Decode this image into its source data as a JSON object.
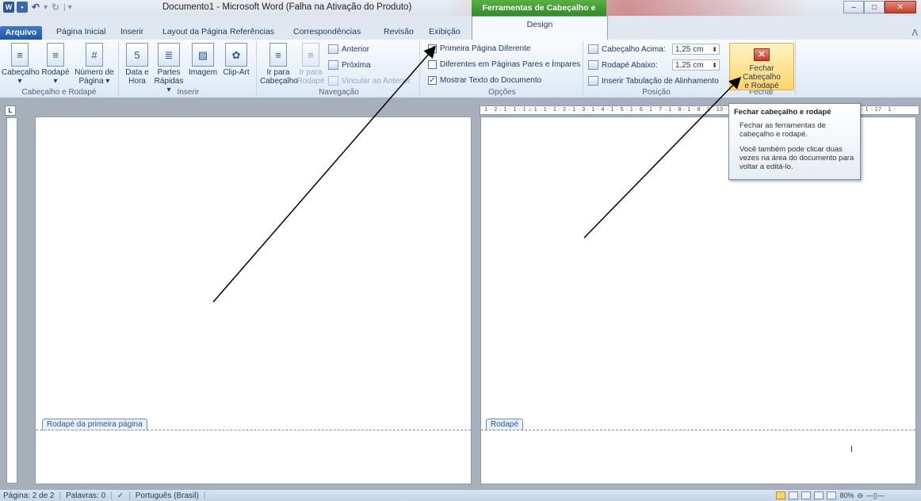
{
  "window": {
    "title": "Documento1 - Microsoft Word (Falha na Ativação do Produto)",
    "contextual_group": "Ferramentas de Cabeçalho e Rodapé"
  },
  "tabs": [
    "Arquivo",
    "Página Inicial",
    "Inserir",
    "Layout da Página",
    "Referências",
    "Correspondências",
    "Revisão",
    "Exibição",
    "Design"
  ],
  "ribbon": {
    "cabecalho_rodape": {
      "title": "Cabeçalho e Rodapé",
      "cabecalho": "Cabeçalho",
      "rodape": "Rodapé",
      "numero_l1": "Número de",
      "numero_l2": "Página"
    },
    "inserir": {
      "title": "Inserir",
      "data_l1": "Data e",
      "data_l2": "Hora",
      "partes_l1": "Partes",
      "partes_l2": "Rápidas",
      "imagem": "Imagem",
      "clipart": "Clip-Art"
    },
    "navegacao": {
      "title": "Navegação",
      "ir_cab_l1": "Ir para",
      "ir_cab_l2": "Cabeçalho",
      "ir_rod_l1": "Ir para",
      "ir_rod_l2": "Rodapé",
      "anterior": "Anterior",
      "proxima": "Próxima",
      "vincular": "Vincular ao Anterior"
    },
    "opcoes": {
      "title": "Opções",
      "primeira": "Primeira Página Diferente",
      "pares": "Diferentes em Páginas Pares e Ímpares",
      "mostrar": "Mostrar Texto do Documento"
    },
    "posicao": {
      "title": "Posição",
      "cab_acima": "Cabeçalho Acima:",
      "cab_acima_val": "1,25 cm",
      "rod_abaixo": "Rodapé Abaixo:",
      "rod_abaixo_val": "1,25 cm",
      "tabulacao": "Inserir Tabulação de Alinhamento"
    },
    "fechar": {
      "title": "Fechar",
      "btn_l1": "Fechar Cabeçalho",
      "btn_l2": "e Rodapé"
    }
  },
  "tooltip": {
    "title": "Fechar cabeçalho e rodapé",
    "desc": "Fechar as ferramentas de cabeçalho e rodapé.",
    "extra": "Você também pode clicar duas vezes na área do documento para voltar a editá-lo."
  },
  "pages": {
    "left_footer": "Rodapé da primeira página",
    "right_footer": "Rodapé"
  },
  "status": {
    "page": "Página: 2 de 2",
    "words": "Palavras: 0",
    "lang": "Português (Brasil)",
    "zoom": "80%"
  },
  "checkboxes": {
    "primeira": true,
    "pares": false,
    "mostrar": true
  }
}
